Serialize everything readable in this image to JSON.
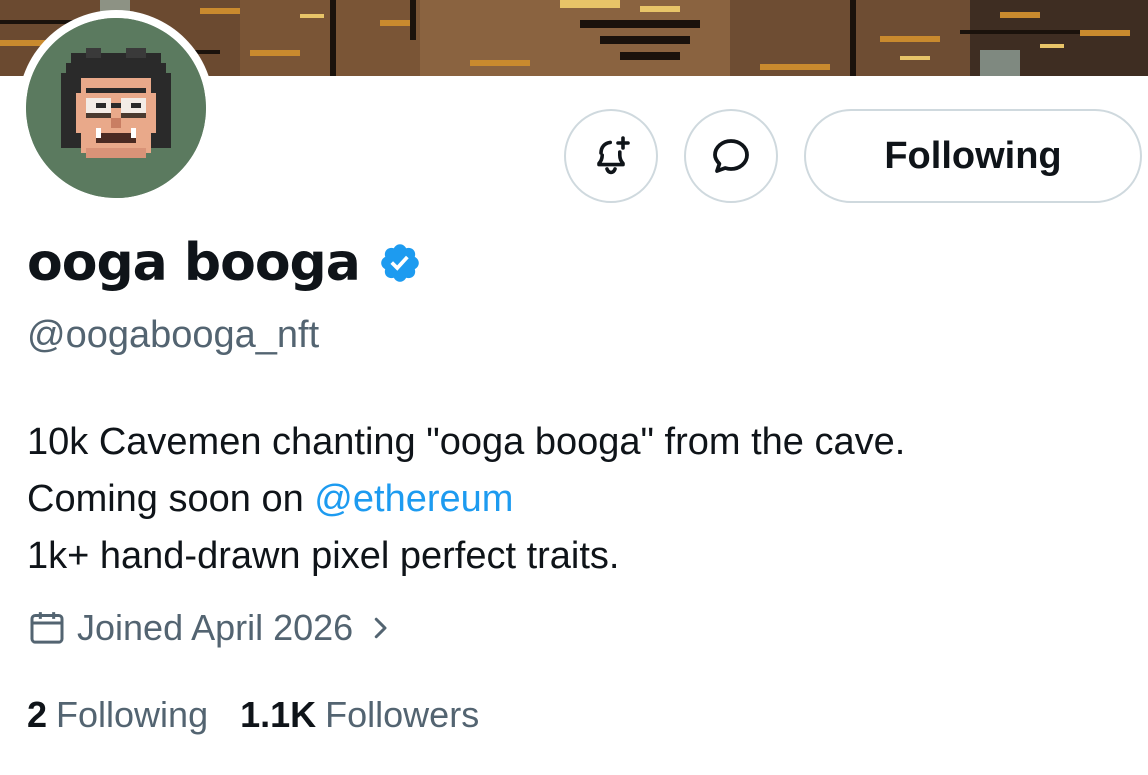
{
  "profile": {
    "display_name": "ooga booga",
    "handle": "@oogabooga_nft",
    "verified_icon": "verified-badge-icon",
    "bio": {
      "line1": "10k Cavemen chanting \"ooga booga\" from the cave.",
      "line2_prefix": "Coming soon on ",
      "line2_mention": "@ethereum",
      "line3": "1k+ hand-drawn pixel perfect traits."
    },
    "joined": "Joined April 2026"
  },
  "actions": {
    "notify_icon": "bell-plus-icon",
    "message_icon": "message-bubble-icon",
    "follow_label": "Following"
  },
  "stats": {
    "following_count": "2",
    "following_label": "Following",
    "followers_count": "1.1K",
    "followers_label": "Followers"
  },
  "colors": {
    "text": "#0f1419",
    "secondary": "#536471",
    "accent": "#1d9bf0",
    "border": "#cfd9de",
    "avatar_bg": "#5b7a5f"
  }
}
